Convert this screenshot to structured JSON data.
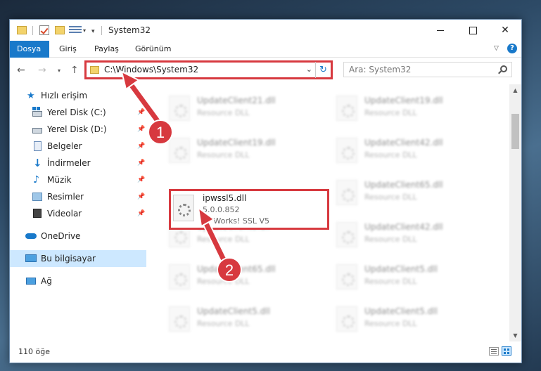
{
  "window": {
    "title": "System32",
    "close_glyph": "✕"
  },
  "ribbon": {
    "tabs": [
      "Dosya",
      "Giriş",
      "Paylaş",
      "Görünüm"
    ],
    "help": "?"
  },
  "nav": {
    "address": "C:\\Windows\\System32",
    "search_placeholder": "Ara: System32"
  },
  "sidebar": {
    "items": [
      {
        "label": "Hızlı erişim",
        "icon": "star-icon"
      },
      {
        "label": "Yerel Disk (C:)",
        "icon": "drive-icon"
      },
      {
        "label": "Yerel Disk (D:)",
        "icon": "drive-icon"
      },
      {
        "label": "Belgeler",
        "icon": "documents-icon"
      },
      {
        "label": "İndirmeler",
        "icon": "downloads-icon"
      },
      {
        "label": "Müzik",
        "icon": "music-icon"
      },
      {
        "label": "Resimler",
        "icon": "pictures-icon"
      },
      {
        "label": "Videolar",
        "icon": "videos-icon"
      },
      {
        "label": "OneDrive",
        "icon": "onedrive-icon"
      },
      {
        "label": "Bu bilgisayar",
        "icon": "this-pc-icon"
      },
      {
        "label": "Ağ",
        "icon": "network-icon"
      }
    ]
  },
  "files": {
    "left": [
      {
        "name": "UpdateClient21.dll",
        "desc": "Resource DLL"
      },
      {
        "name": "UpdateClient19.dll",
        "desc": "Resource DLL"
      },
      {
        "name": "UpdateClient5.dll",
        "desc": "Resource DLL"
      },
      {
        "name": "UpdateClient65.dll",
        "desc": "Resource DLL"
      },
      {
        "name": "UpdateClient5.dll",
        "desc": "Resource DLL"
      }
    ],
    "right": [
      {
        "name": "UpdateClient19.dll",
        "desc": "Resource DLL"
      },
      {
        "name": "UpdateClient42.dll",
        "desc": "Resource DLL"
      },
      {
        "name": "UpdateClient65.dll",
        "desc": "Resource DLL"
      },
      {
        "name": "UpdateClient42.dll",
        "desc": "Resource DLL"
      },
      {
        "name": "UpdateClient5.dll",
        "desc": "Resource DLL"
      },
      {
        "name": "UpdateClient5.dll",
        "desc": "Resource DLL"
      }
    ],
    "highlighted": {
      "name": "ipwssl5.dll",
      "version": "5.0.0.852",
      "desc": "IP*Works! SSL V5"
    }
  },
  "status": {
    "item_count": "110 öğe"
  },
  "annotations": {
    "step1": "1",
    "step2": "2",
    "color": "#d7393f"
  }
}
